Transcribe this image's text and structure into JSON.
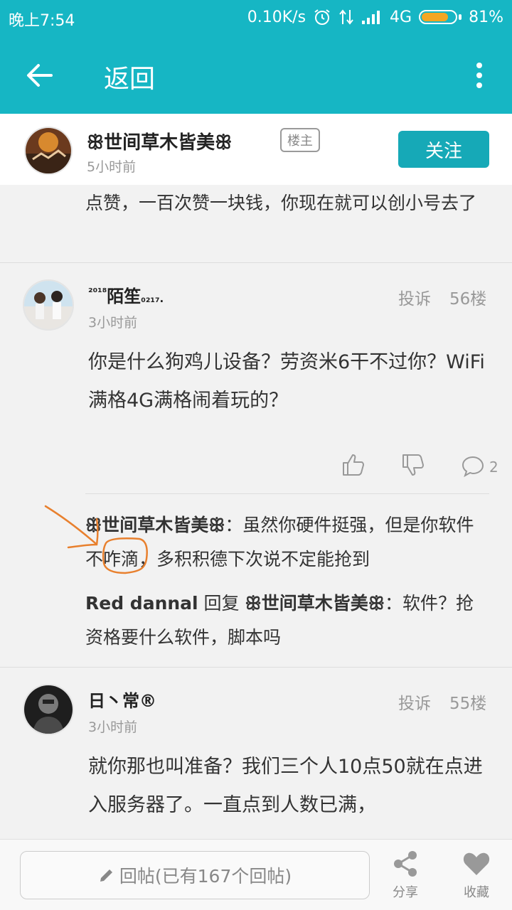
{
  "status_bar": {
    "time": "晚上7:54",
    "speed": "0.10K/s",
    "network": "4G",
    "battery": "81%",
    "battery_level": 0.81
  },
  "app_bar": {
    "back_label": "返回"
  },
  "op": {
    "name": "世间草木皆美",
    "badge": "楼主",
    "time": "5小时前",
    "follow_label": "关注"
  },
  "partial_post": {
    "text": "点赞，一百次赞一块钱，你现在就可以创小号去了"
  },
  "post56": {
    "username_prefix": "²⁰¹⁸",
    "username_main": "陌笙",
    "username_suffix": "₀₂₁₇.",
    "time": "3小时前",
    "report": "投诉",
    "floor": "56楼",
    "content": "你是什么狗鸡儿设备？劳资米6干不过你？WiFi满格4G满格闹着玩的？",
    "comment_count": "2",
    "replies": [
      {
        "author": "世间草木皆美",
        "text_pre": "：虽然你硬件挺强，但是你",
        "text_highlight": "软件",
        "text_post": "不咋滴，多积积德下次说不定能抢到"
      },
      {
        "author": "Red dannal",
        "reply_word": " 回复 ",
        "target": "世间草木皆美",
        "text": "：软件？抢资格要什么软件，脚本吗"
      }
    ]
  },
  "post55": {
    "username": "日丶常®",
    "time": "3小时前",
    "report": "投诉",
    "floor": "55楼",
    "content": "就你那也叫准备？我们三个人10点50就在点进入服务器了。一直点到人数已满，"
  },
  "bottom_bar": {
    "reply_placeholder": "回帖(已有167个回帖)",
    "share_label": "分享",
    "favorite_label": "收藏"
  },
  "colors": {
    "teal": "#16b6c4",
    "button": "#16a9b7",
    "annotation": "#e8802e"
  }
}
